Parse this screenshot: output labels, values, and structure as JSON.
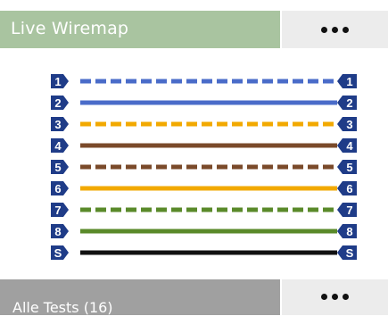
{
  "header": {
    "title": "Live Wiremap",
    "menu_icon": "more-horizontal-icon"
  },
  "footer": {
    "title": "Alle Tests (16)",
    "menu_icon": "more-horizontal-icon"
  },
  "wiremap": {
    "wires": [
      {
        "left_label": "1",
        "right_label": "1",
        "color": "#4a6cc9",
        "style": "dashed"
      },
      {
        "left_label": "2",
        "right_label": "2",
        "color": "#4a6cc9",
        "style": "solid"
      },
      {
        "left_label": "3",
        "right_label": "3",
        "color": "#f2a900",
        "style": "dashed"
      },
      {
        "left_label": "4",
        "right_label": "4",
        "color": "#7a4a2a",
        "style": "solid"
      },
      {
        "left_label": "5",
        "right_label": "5",
        "color": "#7a4a2a",
        "style": "dashed"
      },
      {
        "left_label": "6",
        "right_label": "6",
        "color": "#f2a900",
        "style": "solid"
      },
      {
        "left_label": "7",
        "right_label": "7",
        "color": "#5a8a2a",
        "style": "dashed"
      },
      {
        "left_label": "8",
        "right_label": "8",
        "color": "#5a8a2a",
        "style": "solid"
      },
      {
        "left_label": "S",
        "right_label": "S",
        "color": "#111111",
        "style": "solid"
      }
    ],
    "badge_color": "#1f3c88"
  }
}
